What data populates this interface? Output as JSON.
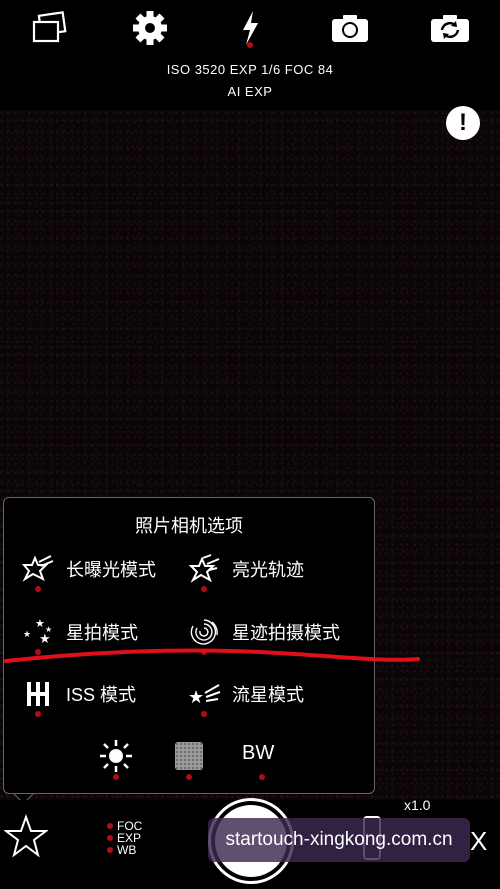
{
  "top_toolbar": {
    "info_line_1": "ISO 3520 EXP 1/6 FOC 84",
    "info_line_2": "AI EXP",
    "icons": [
      "gallery-icon",
      "settings-icon",
      "flash-icon",
      "camera-icon",
      "switch-camera-icon"
    ]
  },
  "warning": {
    "symbol": "!"
  },
  "panel": {
    "title": "照片相机选项",
    "options": [
      {
        "label": "长曝光模式",
        "icon": "long-exposure-icon"
      },
      {
        "label": "亮光轨迹",
        "icon": "light-trail-icon"
      },
      {
        "label": "星拍模式",
        "icon": "star-mode-icon"
      },
      {
        "label": "星迹拍摄模式",
        "icon": "star-trail-icon"
      },
      {
        "label": "ISS 模式",
        "icon": "iss-icon"
      },
      {
        "label": "流星模式",
        "icon": "meteor-icon"
      }
    ],
    "bottom_row": {
      "bw_label": "BW"
    }
  },
  "bottom_bar": {
    "zoom": "x1.0",
    "foc": "FOC",
    "exp": "EXP",
    "wb": "WB",
    "watermark": "startouch-xingkong.com.cn",
    "close": "X"
  },
  "colors": {
    "accent_red": "#b10d12",
    "annotation_red": "#e0101a"
  }
}
